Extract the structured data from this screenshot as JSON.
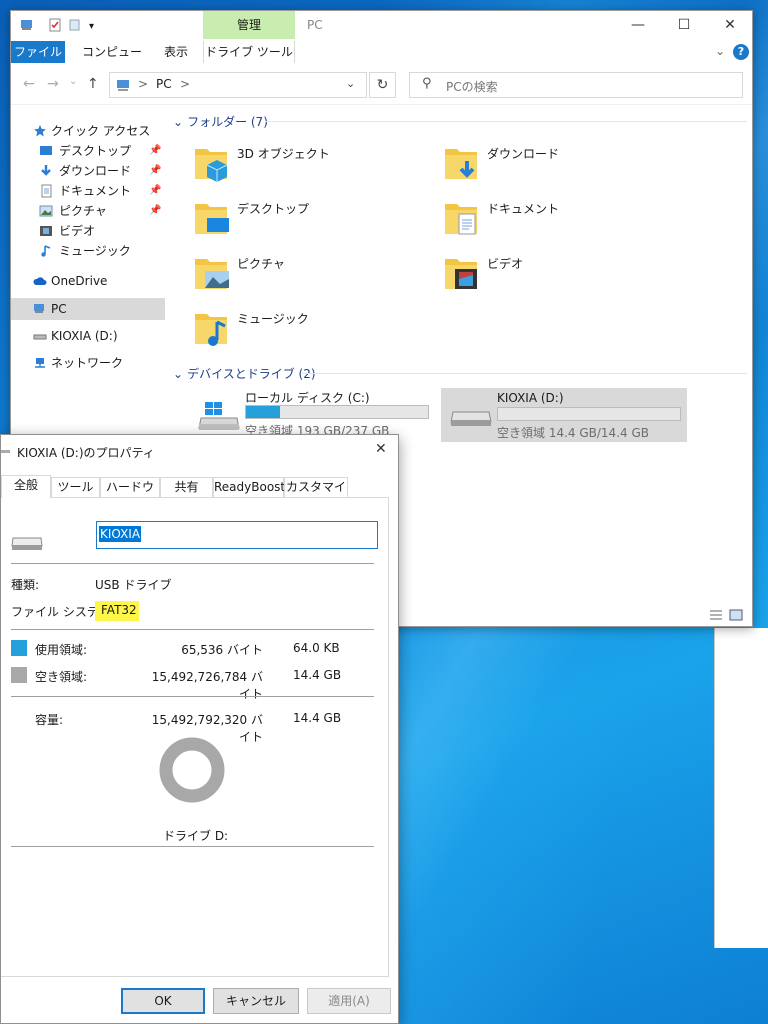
{
  "explorer": {
    "title": "PC",
    "context_tab_header": "管理",
    "ribbon_tabs": [
      "ファイル",
      "コンピューター",
      "表示",
      "ドライブ ツール"
    ],
    "help_label": "?",
    "address": {
      "crumb_sep": ">",
      "crumb": "PC",
      "crumb_end": ">"
    },
    "search_placeholder": "PCの検索",
    "nav": [
      {
        "label": "クイック アクセス",
        "icon": "star-icon"
      },
      {
        "label": "デスクトップ",
        "icon": "desktop-icon",
        "pinned": true
      },
      {
        "label": "ダウンロード",
        "icon": "download-icon",
        "pinned": true
      },
      {
        "label": "ドキュメント",
        "icon": "document-icon",
        "pinned": true
      },
      {
        "label": "ピクチャ",
        "icon": "picture-icon",
        "pinned": true
      },
      {
        "label": "ビデオ",
        "icon": "video-icon"
      },
      {
        "label": "ミュージック",
        "icon": "music-icon"
      },
      {
        "label": "OneDrive",
        "icon": "cloud-icon"
      },
      {
        "label": "PC",
        "icon": "pc-icon",
        "selected": true
      },
      {
        "label": "KIOXIA (D:)",
        "icon": "usb-drive-icon"
      },
      {
        "label": "ネットワーク",
        "icon": "network-icon"
      }
    ],
    "folders_header": "フォルダー (7)",
    "folders": [
      {
        "name": "3D オブジェクト",
        "icon": "3d-objects-folder-icon"
      },
      {
        "name": "ダウンロード",
        "icon": "downloads-folder-icon"
      },
      {
        "name": "デスクトップ",
        "icon": "desktop-folder-icon"
      },
      {
        "name": "ドキュメント",
        "icon": "documents-folder-icon"
      },
      {
        "name": "ピクチャ",
        "icon": "pictures-folder-icon"
      },
      {
        "name": "ビデオ",
        "icon": "videos-folder-icon"
      },
      {
        "name": "ミュージック",
        "icon": "music-folder-icon"
      }
    ],
    "drives_header": "デバイスとドライブ (2)",
    "drives": [
      {
        "name": "ローカル ディスク (C:)",
        "free_text": "空き領域 193 GB/237 GB",
        "used_fraction": 0.186,
        "selected": false
      },
      {
        "name": "KIOXIA (D:)",
        "free_text": "空き領域 14.4 GB/14.4 GB",
        "used_fraction": 0.0,
        "selected": true
      }
    ]
  },
  "dialog": {
    "title": "KIOXIA (D:)のプロパティ",
    "close": "✕",
    "tabs": [
      "全般",
      "ツール",
      "ハードウェア",
      "共有",
      "ReadyBoost",
      "カスタマイズ"
    ],
    "volume_label": "KIOXIA",
    "type_label": "種類:",
    "type_value": "USB ドライブ",
    "fs_label": "ファイル システム:",
    "fs_value": "FAT32",
    "used_label": "使用領域:",
    "used_bytes": "65,536 バイト",
    "used_size": "64.0 KB",
    "free_label": "空き領域:",
    "free_bytes": "15,492,726,784 バイト",
    "free_size": "14.4 GB",
    "capacity_label": "容量:",
    "capacity_bytes": "15,492,792,320 バイト",
    "capacity_size": "14.4 GB",
    "drive_caption": "ドライブ D:",
    "used_fraction": 4.2e-06,
    "buttons": {
      "ok": "OK",
      "cancel": "キャンセル",
      "apply": "適用(A)"
    },
    "colors": {
      "used": "#26a0da",
      "free": "#a8a8a8",
      "highlight": "#fff64a"
    }
  }
}
